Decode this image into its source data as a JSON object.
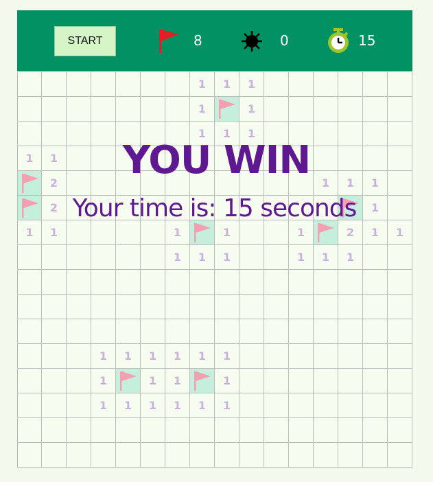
{
  "header": {
    "start_label": "START",
    "flags_count": "8",
    "mines_count": "0",
    "timer_value": "15",
    "colors": {
      "bar": "#019162",
      "flag": "#e31e24",
      "timer": "#9ec52b"
    }
  },
  "overlay": {
    "title": "YOU WIN",
    "message": "Your time is: 15 seconds"
  },
  "board": {
    "rows": 16,
    "cols": 16,
    "cells": [
      [
        "",
        "",
        "",
        "",
        "",
        "",
        "",
        "1",
        "1",
        "1",
        "",
        "",
        "",
        "",
        "",
        ""
      ],
      [
        "",
        "",
        "",
        "",
        "",
        "",
        "",
        "1",
        "F",
        "1",
        "",
        "",
        "",
        "",
        "",
        ""
      ],
      [
        "",
        "",
        "",
        "",
        "",
        "",
        "",
        "1",
        "1",
        "1",
        "",
        "",
        "",
        "",
        "",
        ""
      ],
      [
        "1",
        "1",
        "",
        "",
        "",
        "",
        "",
        "",
        "",
        "",
        "",
        "",
        "",
        "",
        "",
        ""
      ],
      [
        "F",
        "2",
        "",
        "",
        "",
        "",
        "",
        "",
        "",
        "",
        "",
        "",
        "1",
        "1",
        "1",
        ""
      ],
      [
        "F",
        "2",
        "",
        "",
        "",
        "",
        "",
        "",
        "",
        "",
        "",
        "",
        "",
        "F",
        "1",
        ""
      ],
      [
        "1",
        "1",
        "",
        "",
        "",
        "",
        "1",
        "F",
        "1",
        "",
        "",
        "1",
        "F",
        "2",
        "1",
        "1"
      ],
      [
        "",
        "",
        "",
        "",
        "",
        "",
        "1",
        "1",
        "1",
        "",
        "",
        "1",
        "1",
        "1",
        "",
        ""
      ],
      [
        "",
        "",
        "",
        "",
        "",
        "",
        "",
        "",
        "",
        "",
        "",
        "",
        "",
        "",
        "",
        ""
      ],
      [
        "",
        "",
        "",
        "",
        "",
        "",
        "",
        "",
        "",
        "",
        "",
        "",
        "",
        "",
        "",
        ""
      ],
      [
        "",
        "",
        "",
        "",
        "",
        "",
        "",
        "",
        "",
        "",
        "",
        "",
        "",
        "",
        "",
        ""
      ],
      [
        "",
        "",
        "",
        "1",
        "1",
        "1",
        "1",
        "1",
        "1",
        "",
        "",
        "",
        "",
        "",
        "",
        ""
      ],
      [
        "",
        "",
        "",
        "1",
        "F",
        "1",
        "1",
        "F",
        "1",
        "",
        "",
        "",
        "",
        "",
        "",
        ""
      ],
      [
        "",
        "",
        "",
        "1",
        "1",
        "1",
        "1",
        "1",
        "1",
        "",
        "",
        "",
        "",
        "",
        "",
        ""
      ],
      [
        "",
        "",
        "",
        "",
        "",
        "",
        "",
        "",
        "",
        "",
        "",
        "",
        "",
        "",
        "",
        ""
      ],
      [
        "",
        "",
        "",
        "",
        "",
        "",
        "",
        "",
        "",
        "",
        "",
        "",
        "",
        "",
        "",
        ""
      ]
    ]
  }
}
